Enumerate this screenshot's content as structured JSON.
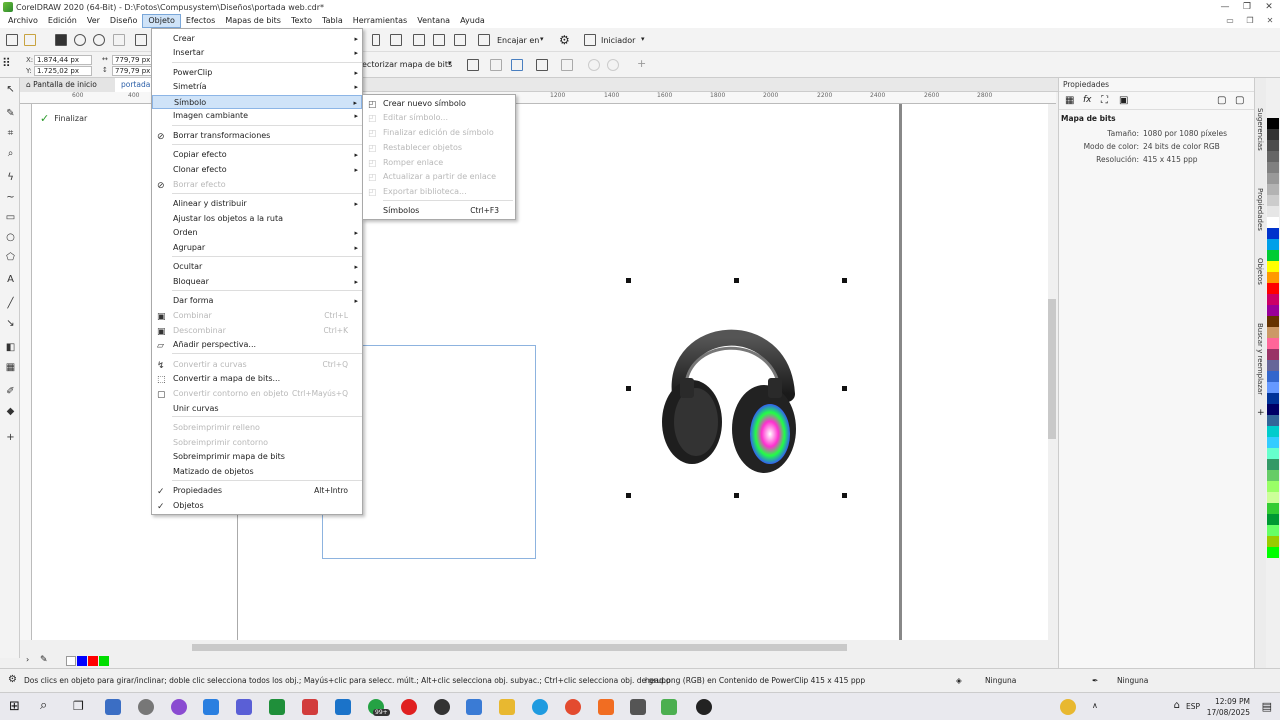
{
  "window": {
    "title": "CorelDRAW 2020 (64-Bit) - D:\\Fotos\\Compusystem\\Diseños\\portada web.cdr*"
  },
  "menubar": [
    "Archivo",
    "Edición",
    "Ver",
    "Diseño",
    "Objeto",
    "Efectos",
    "Mapas de bits",
    "Texto",
    "Tabla",
    "Herramientas",
    "Ventana",
    "Ayuda"
  ],
  "toolbar": {
    "snap_label": "Encajar en",
    "launcher_label": "Iniciador",
    "vectorize_label": "ectorizar mapa de bits",
    "x_label": "X:",
    "x_value": "1.874,44 px",
    "y_label": "Y:",
    "y_value": "1.725,02 px",
    "w_value": "779,79 px",
    "h_value": "779,79 px"
  },
  "doc_tabs": {
    "home": "Pantalla de inicio",
    "document": "portada w"
  },
  "ruler_ticks": [
    "600",
    "400",
    "1200",
    "1400",
    "1600",
    "1800",
    "2000",
    "2200",
    "2400",
    "2600",
    "2800"
  ],
  "canvas": {
    "finalize_label": "Finalizar"
  },
  "objeto_menu": [
    {
      "label": "Crear",
      "arrow": true
    },
    {
      "label": "Insertar",
      "arrow": true
    },
    {
      "label": "PowerClip",
      "arrow": true
    },
    {
      "label": "Simetría",
      "arrow": true
    },
    {
      "label": "Símbolo",
      "arrow": true
    },
    {
      "label": "Imagen cambiante",
      "arrow": true
    },
    {
      "label": "Borrar transformaciones"
    },
    {
      "label": "Copiar efecto",
      "arrow": true
    },
    {
      "label": "Clonar efecto",
      "arrow": true
    },
    {
      "label": "Borrar efecto"
    },
    {
      "label": "Alinear y distribuir",
      "arrow": true
    },
    {
      "label": "Ajustar los objetos a la ruta"
    },
    {
      "label": "Orden",
      "arrow": true
    },
    {
      "label": "Agrupar",
      "arrow": true
    },
    {
      "label": "Ocultar",
      "arrow": true
    },
    {
      "label": "Bloquear",
      "arrow": true
    },
    {
      "label": "Dar forma",
      "arrow": true
    },
    {
      "label": "Combinar",
      "shortcut": "Ctrl+L"
    },
    {
      "label": "Descombinar",
      "shortcut": "Ctrl+K"
    },
    {
      "label": "Añadir perspectiva..."
    },
    {
      "label": "Convertir a curvas",
      "shortcut": "Ctrl+Q"
    },
    {
      "label": "Convertir a mapa de bits..."
    },
    {
      "label": "Convertir contorno en objeto",
      "shortcut": "Ctrl+Mayús+Q"
    },
    {
      "label": "Unir curvas"
    },
    {
      "label": "Sobreimprimir relleno"
    },
    {
      "label": "Sobreimprimir contorno"
    },
    {
      "label": "Sobreimprimir mapa de bits"
    },
    {
      "label": "Matizado de objetos"
    },
    {
      "label": "Propiedades",
      "shortcut": "Alt+Intro"
    },
    {
      "label": "Objetos"
    }
  ],
  "symbol_submenu": [
    {
      "label": "Crear nuevo símbolo"
    },
    {
      "label": "Editar símbolo..."
    },
    {
      "label": "Finalizar edición de símbolo"
    },
    {
      "label": "Restablecer objetos"
    },
    {
      "label": "Romper enlace"
    },
    {
      "label": "Actualizar a partir de enlace"
    },
    {
      "label": "Exportar biblioteca..."
    },
    {
      "label": "Símbolos",
      "shortcut": "Ctrl+F3"
    }
  ],
  "properties": {
    "title": "Propiedades",
    "section": "Mapa de bits",
    "rows": [
      {
        "k": "Tamaño:",
        "v": "1080 por 1080 píxeles"
      },
      {
        "k": "Modo de color:",
        "v": "24 bits de color RGB"
      },
      {
        "k": "Resolución:",
        "v": "415 x 415 ppp"
      }
    ]
  },
  "dock_tabs": [
    "Sugerencias",
    "Propiedades",
    "Objetos",
    "Buscar y reemplazar"
  ],
  "status": {
    "hint": "Dos clics en objeto para girar/inclinar; doble clic selecciona todos los obj.; Mayús+clic para selecc. múlt.; Alt+clic selecciona obj. subyac.; Ctrl+clic selecciona obj. de grupo",
    "object_info": "head.png (RGB) en Contenido de PowerClip 415 x 415 ppp",
    "fill": "Ninguna",
    "outline": "Ninguna"
  },
  "taskbar": {
    "badge": "99+",
    "lang": "ESP",
    "time": "12:09 PM",
    "date": "17/08/2025"
  },
  "palette_colors": [
    "#000000",
    "#333333",
    "#4d4d4d",
    "#666666",
    "#808080",
    "#999999",
    "#b3b3b3",
    "#cccccc",
    "#e6e6e6",
    "#ffffff",
    "#0033cc",
    "#00a0e9",
    "#00cc33",
    "#ffff00",
    "#ff9900",
    "#ff0000",
    "#cc0066",
    "#990099",
    "#663300",
    "#cc9966",
    "#ff6699",
    "#993366",
    "#666699",
    "#3366cc",
    "#6699ff",
    "#003399",
    "#000066",
    "#336699",
    "#00cccc",
    "#33ccff",
    "#66ffcc",
    "#339966",
    "#66cc66",
    "#99ff66",
    "#ccff99",
    "#33cc33",
    "#009933",
    "#66ff66",
    "#99cc00",
    "#00ff00"
  ]
}
